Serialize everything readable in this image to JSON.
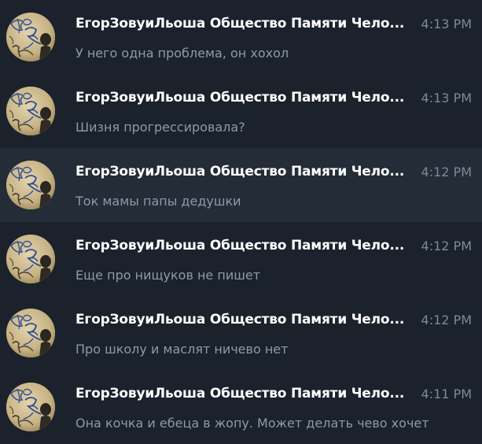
{
  "colors": {
    "background": "#1b222b",
    "selected_row": "#232c37",
    "name_text": "#ffffff",
    "message_text": "#8d9aa8",
    "time_text": "#7d8a98"
  },
  "chats": [
    {
      "name": "ЕгорЗовуиЛьоша Общество Памяти Чело...",
      "time": "4:13 PM",
      "message": "У него одна проблема, он хохол",
      "avatar_icon": "jojo-rabbit-avatar-icon"
    },
    {
      "name": "ЕгорЗовуиЛьоша Общество Памяти Чело...",
      "time": "4:13 PM",
      "message": "Шизня прогрессировала?",
      "avatar_icon": "jojo-rabbit-avatar-icon"
    },
    {
      "name": "ЕгорЗовуиЛьоша Общество Памяти Чело...",
      "time": "4:12 PM",
      "message": "Ток мамы папы дедушки",
      "avatar_icon": "jojo-rabbit-avatar-icon",
      "selected": true
    },
    {
      "name": "ЕгорЗовуиЛьоша Общество Памяти Чело...",
      "time": "4:12 PM",
      "message": "Еще про нищуков не пишет",
      "avatar_icon": "jojo-rabbit-avatar-icon"
    },
    {
      "name": "ЕгорЗовуиЛьоша Общество Памяти Чело...",
      "time": "4:12 PM",
      "message": "Про школу и маслят ничево нет",
      "avatar_icon": "jojo-rabbit-avatar-icon"
    },
    {
      "name": "ЕгорЗовуиЛьоша Общество Памяти Чело...",
      "time": "4:11 PM",
      "message": "Она кочка и ебеца в жопу. Может делать чево хочет",
      "avatar_icon": "jojo-rabbit-avatar-icon"
    }
  ]
}
